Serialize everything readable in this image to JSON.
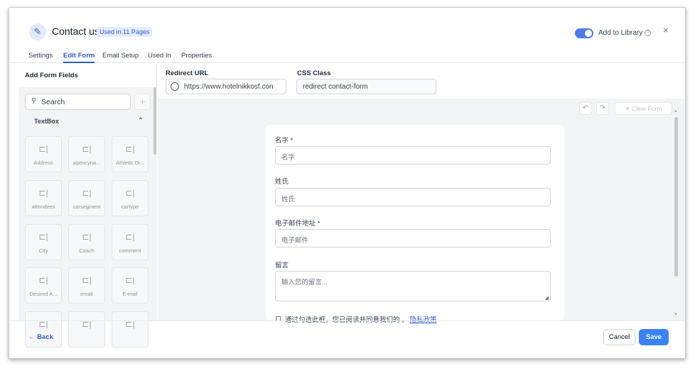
{
  "header": {
    "title": "Contact us",
    "badge": "Used in 11 Pages",
    "library_label": "Add to Library",
    "library_enabled": true,
    "help_icon": "?",
    "close_icon": "×"
  },
  "tabs": [
    {
      "label": "Settings",
      "active": false
    },
    {
      "label": "Edit Form",
      "active": true
    },
    {
      "label": "Email Setup",
      "active": false
    },
    {
      "label": "Used In",
      "active": false
    },
    {
      "label": "Properties",
      "active": false
    }
  ],
  "sidebar": {
    "title": "Add Form Fields",
    "search_placeholder": "Search",
    "add_icon": "+",
    "group_label": "TextBox",
    "group_chevron": "⌃",
    "fields": [
      "Address",
      "agencyna...",
      "Athletic Di...",
      "attendees",
      "carsegment",
      "cartype",
      "City",
      "Coach",
      "comment",
      "Desired A...",
      "email",
      "E-mail",
      "",
      "",
      ""
    ]
  },
  "settings": {
    "redirect_label": "Redirect URL",
    "redirect_value": "https://www.hotelnikkosf.con",
    "css_label": "CSS Class",
    "css_value": "redirect contact-form"
  },
  "toolbar": {
    "undo_icon": "↶",
    "redo_icon": "↷",
    "clear_label": "✕  Clear Form"
  },
  "form": {
    "fields": [
      {
        "label": "名字 *",
        "placeholder": "名字"
      },
      {
        "label": "姓氏",
        "placeholder": "姓氏"
      },
      {
        "label": "电子邮件地址 *",
        "placeholder": "电子邮件"
      }
    ],
    "message": {
      "label": "留言",
      "placeholder": "输入您的留言..."
    },
    "consent_text": "通过勾选此框，您已阅读并同意我们的 。",
    "consent_link": "隐私政策"
  },
  "footer": {
    "back_label": "←  Back",
    "cancel_label": "Cancel",
    "save_label": "Save"
  },
  "colors": {
    "accent": "#2f5bd3",
    "save_button": "#3b82f6"
  }
}
